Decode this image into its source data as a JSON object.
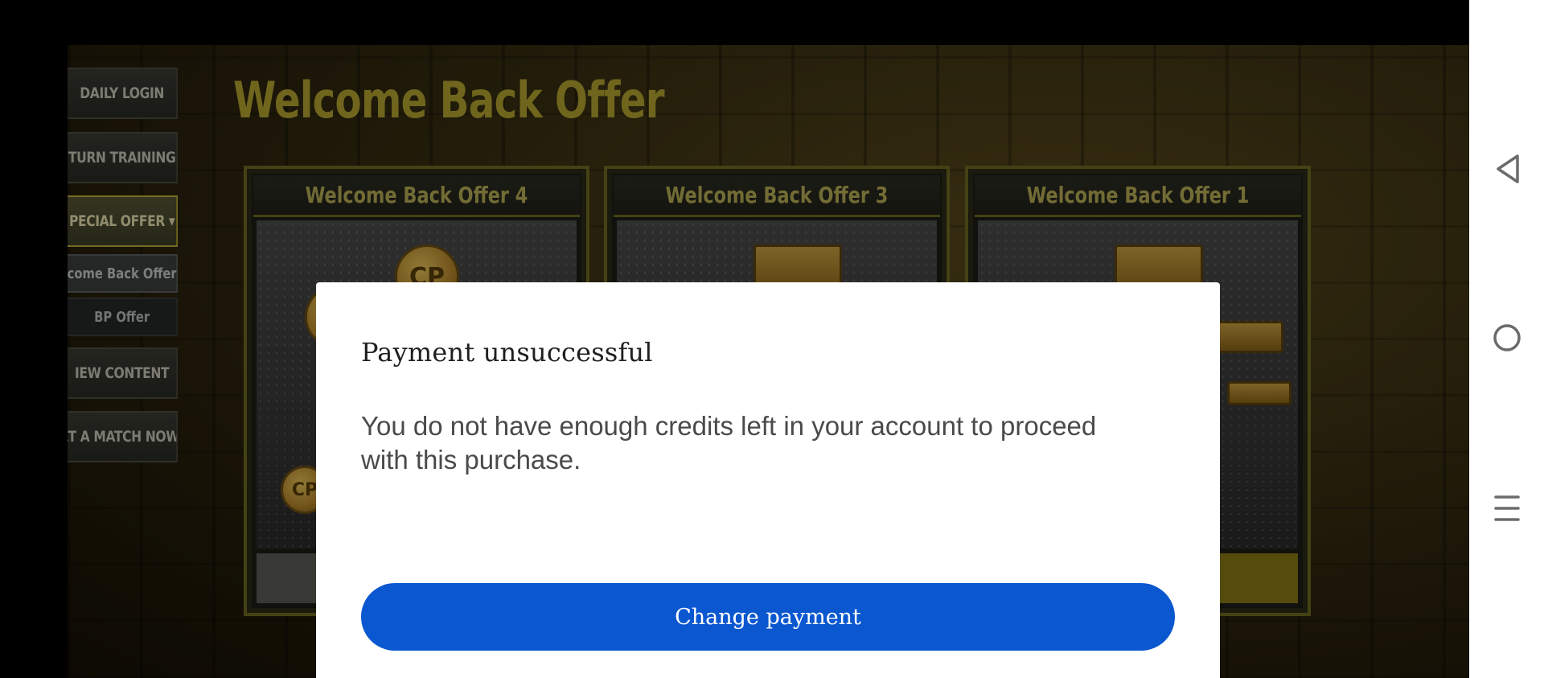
{
  "game": {
    "side_menu": {
      "items": [
        {
          "label": "DAILY LOGIN"
        },
        {
          "label": "TURN TRAINING"
        },
        {
          "label": "PECIAL OFFER ▾"
        },
        {
          "label": "come Back Offer"
        },
        {
          "label": "BP Offer"
        },
        {
          "label": "IEW CONTENT"
        },
        {
          "label": "RT A MATCH NOW!"
        }
      ]
    },
    "title": "Welcome Back Offer",
    "cards": [
      {
        "title": "Welcome Back Offer 4",
        "coin_label": "CP"
      },
      {
        "title": "Welcome Back Offer 3"
      },
      {
        "title": "Welcome Back Offer 1"
      }
    ]
  },
  "dialog": {
    "title": "Payment unsuccessful",
    "message": "You do not have enough credits left in your account to proceed with this purchase.",
    "button_label": "Change payment"
  },
  "navbar": {
    "icons": [
      "back-icon",
      "home-icon",
      "recents-icon"
    ]
  },
  "colors": {
    "primary_button": "#0b57d0",
    "game_title": "#b3a42f"
  }
}
